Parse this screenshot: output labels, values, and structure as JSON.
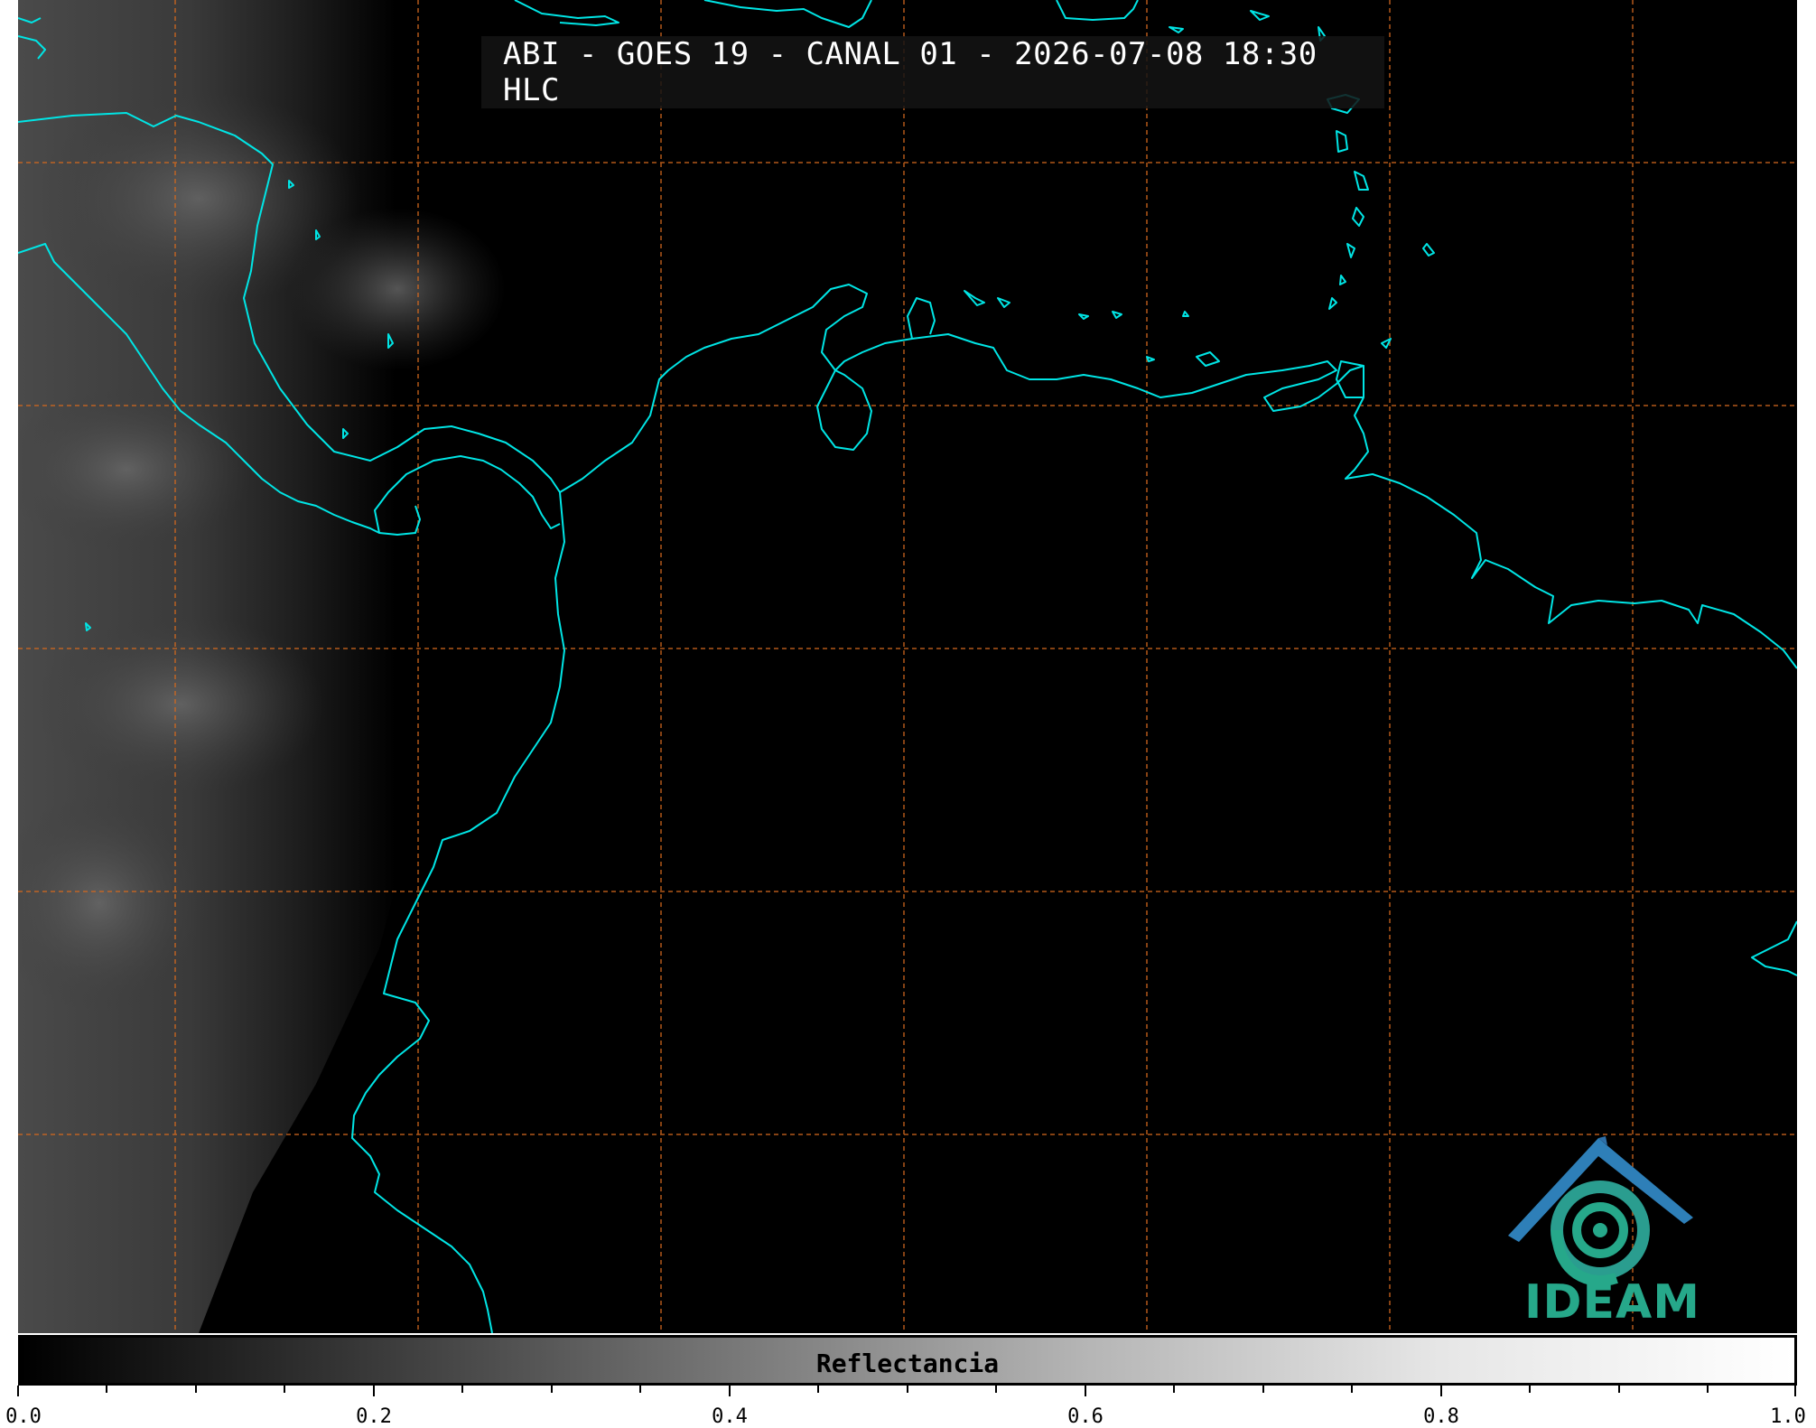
{
  "title": "ABI - GOES 19 - CANAL 01 - 2026-07-08 18:30 HLC",
  "colorbar": {
    "label": "Reflectancia",
    "ticks": [
      "0.0",
      "0.2",
      "0.4",
      "0.6",
      "0.8",
      "1.0"
    ]
  },
  "logo": {
    "text": "IDEAM"
  },
  "colors": {
    "coastline": "#00e5e5",
    "grid": "#d2691e",
    "background": "#000000",
    "logo_blue": "#2e7fb8",
    "logo_green": "#26a88a"
  },
  "icons": [
    "ideam-logo-icon"
  ]
}
